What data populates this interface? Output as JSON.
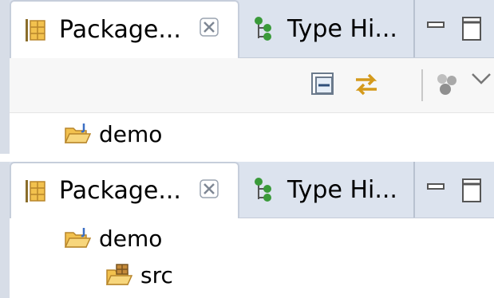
{
  "panels": [
    {
      "tabs": {
        "active_label": "Package...",
        "inactive_label": "Type Hi..."
      },
      "tree": [
        {
          "label": "demo",
          "icon": "project-folder-icon"
        }
      ]
    },
    {
      "tabs": {
        "active_label": "Package...",
        "inactive_label": "Type Hi..."
      },
      "tree": [
        {
          "label": "demo",
          "icon": "project-folder-icon"
        },
        {
          "label": "src",
          "icon": "source-folder-icon"
        }
      ]
    }
  ],
  "colors": {
    "tabbar_bg": "#dce3ee",
    "active_tab_bg": "#ffffff",
    "toolbar_bg": "#f7f7f7",
    "folder_yellow": "#f2c14e",
    "project_blue": "#3b6fc4",
    "hierarchy_green": "#3a9a3a"
  }
}
